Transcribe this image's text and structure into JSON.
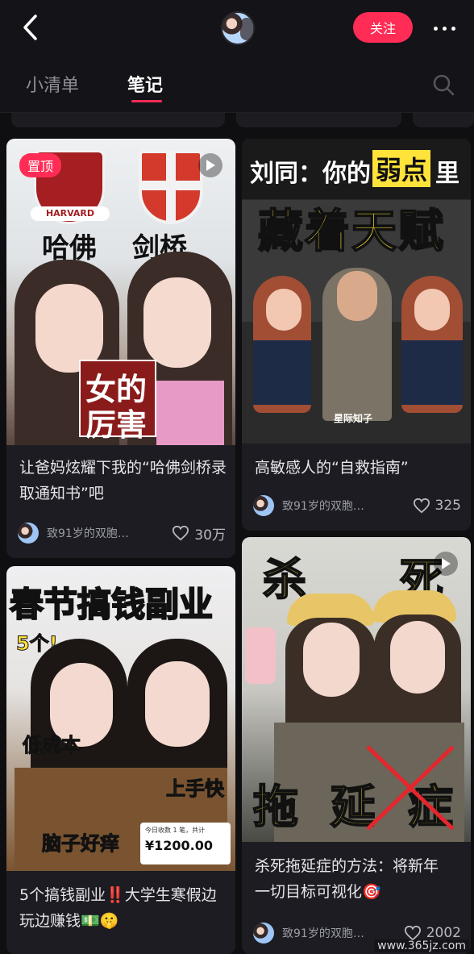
{
  "header": {
    "back_icon": "chevron-left-icon",
    "follow_label": "关注",
    "more_icon": "more-horizontal-icon"
  },
  "tabs": [
    {
      "label": "小清单",
      "active": false
    },
    {
      "label": "笔记",
      "active": true
    }
  ],
  "search_icon": "search-icon",
  "cards": [
    {
      "title": "让爸妈炫耀下我的“哈佛剑桥录取通知书”吧",
      "author": "致91岁的双胞…",
      "likes": "30万",
      "pin_label": "置顶",
      "cover_text": {
        "t1": "哈佛",
        "t2": "剑桥",
        "t3": "女的",
        "t4": "厉害",
        "harvard": "HARVARD"
      }
    },
    {
      "title": "高敏感人的“自救指南”",
      "author": "致91岁的双胞…",
      "likes": "325",
      "cover_text": {
        "line1": "刘同：你的",
        "hl": "弱点",
        "line1b": "里",
        "line2": "藏着天赋",
        "logo": "星际知子"
      }
    },
    {
      "title": "5个搞钱副业‼️大学生寒假边玩边赚钱💵🤫",
      "author": "",
      "likes": "",
      "cover_text": {
        "h1": "春节搞钱副业",
        "h2": "5个!",
        "a": "低成本",
        "b": "上手快",
        "c": "脑子好痒",
        "note_label": "今日收数 1 笔，共计",
        "amount": "¥1200.00"
      }
    },
    {
      "title": "杀死拖延症的方法：将新年一切目标可视化🎯",
      "author": "致91岁的双胞…",
      "likes": "2002",
      "cover_text": {
        "k1": "杀",
        "k2": "死",
        "k3": "拖",
        "k4": "延",
        "k5": "症"
      }
    }
  ],
  "watermark": "www.365jz.com",
  "colors": {
    "accent": "#ff2c55",
    "background": "#0f0f12",
    "card": "#1c1c22"
  }
}
